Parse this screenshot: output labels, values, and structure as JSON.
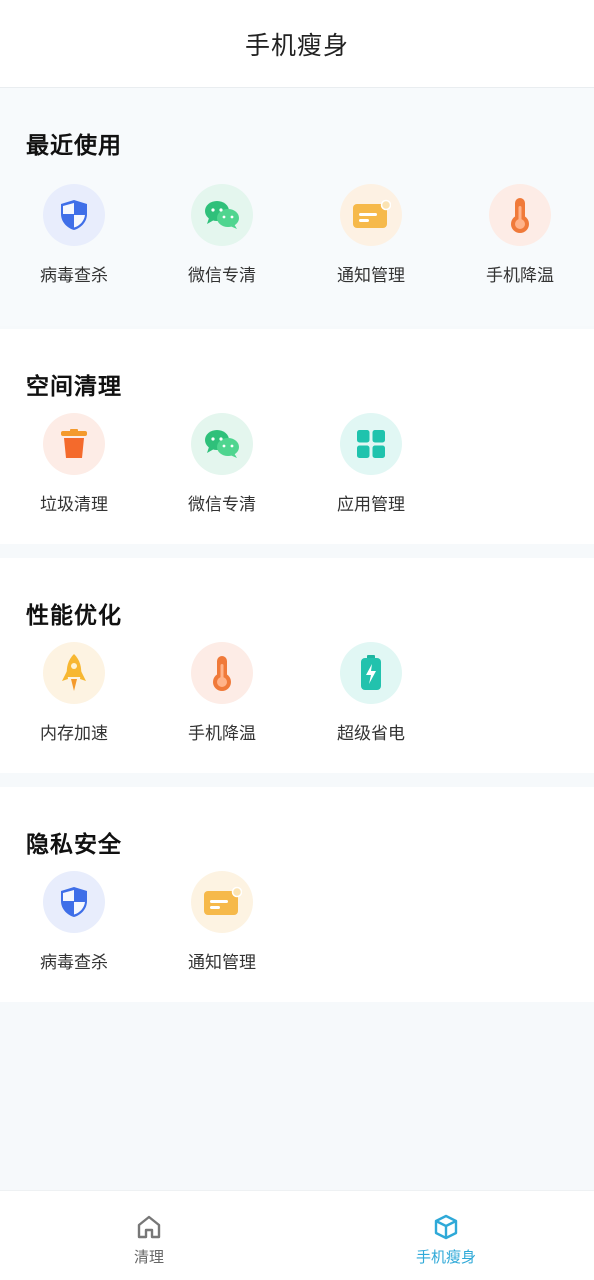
{
  "header": {
    "title": "手机瘦身"
  },
  "sections": [
    {
      "title": "最近使用",
      "items": [
        {
          "label": "病毒查杀",
          "icon": "shield-icon"
        },
        {
          "label": "微信专清",
          "icon": "wechat-icon"
        },
        {
          "label": "通知管理",
          "icon": "notification-icon"
        },
        {
          "label": "手机降温",
          "icon": "thermometer-icon"
        }
      ]
    },
    {
      "title": "空间清理",
      "items": [
        {
          "label": "垃圾清理",
          "icon": "trash-icon"
        },
        {
          "label": "微信专清",
          "icon": "wechat-icon"
        },
        {
          "label": "应用管理",
          "icon": "apps-grid-icon"
        }
      ]
    },
    {
      "title": "性能优化",
      "items": [
        {
          "label": "内存加速",
          "icon": "rocket-icon"
        },
        {
          "label": "手机降温",
          "icon": "thermometer-icon"
        },
        {
          "label": "超级省电",
          "icon": "battery-icon"
        }
      ]
    },
    {
      "title": "隐私安全",
      "items": [
        {
          "label": "病毒查杀",
          "icon": "shield-icon"
        },
        {
          "label": "通知管理",
          "icon": "notification-icon"
        }
      ]
    }
  ],
  "tabbar": {
    "tabs": [
      {
        "label": "清理",
        "icon": "home-icon",
        "active": false
      },
      {
        "label": "手机瘦身",
        "icon": "box-icon",
        "active": true
      }
    ],
    "active_color": "#2fa9d8"
  }
}
